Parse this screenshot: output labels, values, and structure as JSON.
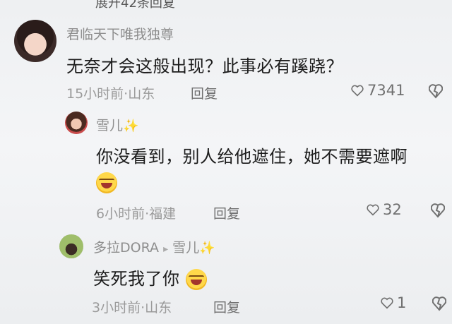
{
  "top": {
    "cutoff_text": "展开42条回复"
  },
  "comments": [
    {
      "username": "君临天下唯我独尊",
      "text": "无奈才会这般出现？此事必有蹊跷？",
      "meta": "15小时前·山东",
      "reply_label": "回复",
      "likes": "7341"
    },
    {
      "username": "雪儿",
      "sparkle": "✨",
      "text": "你没看到，别人给他遮住，她不需要遮啊",
      "meta": "6小时前·福建",
      "reply_label": "回复",
      "likes": "32"
    },
    {
      "username": "多拉DORA",
      "arrow": "▸",
      "reply_to": "雪儿",
      "sparkle": "✨",
      "text": "笑死我了你",
      "meta": "3小时前·山东",
      "reply_label": "回复",
      "likes": "1"
    }
  ],
  "icons": {
    "like": "heart-icon",
    "dislike": "dislike-icon",
    "emoji": "laughing-crying-emoji"
  },
  "colors": {
    "text_primary": "#1c1c1c",
    "text_secondary": "#8e8e8e",
    "background": "#eef0f2"
  }
}
